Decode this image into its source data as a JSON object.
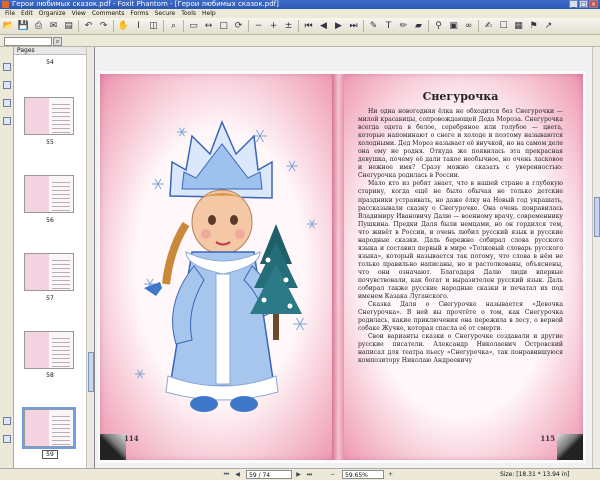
{
  "window": {
    "title": "Герои любимых сказок.pdf - Foxit Phantom - [Герои любимых сказок.pdf]"
  },
  "menu": [
    "File",
    "Edit",
    "Organize",
    "View",
    "Comments",
    "Forms",
    "Secure",
    "Tools",
    "Help"
  ],
  "toolbar": {
    "icons": [
      "open-icon",
      "save-icon",
      "print-icon",
      "email-icon",
      "scan-icon",
      "sep",
      "undo-icon",
      "redo-icon",
      "sep",
      "hand-icon",
      "select-text-icon",
      "snapshot-icon",
      "sep",
      "zoom-icon",
      "sep",
      "fit-page-icon",
      "fit-width-icon",
      "actual-size-icon",
      "rotate-icon",
      "sep",
      "zoom-out-icon",
      "zoom-in-icon",
      "zoom-in-out-icon",
      "sep",
      "first-page-icon",
      "prev-page-icon",
      "next-page-icon",
      "last-page-icon",
      "sep",
      "comment-icon",
      "typewriter-icon",
      "pencil-icon",
      "highlight-icon",
      "sep",
      "attach-icon",
      "stamp-icon",
      "link-icon",
      "sep",
      "sign-icon",
      "form-icon",
      "grid-icon",
      "bookmark-icon",
      "extract-icon"
    ]
  },
  "pages_panel": {
    "title": "Pages",
    "thumbnails": [
      {
        "label": "54",
        "selected": false
      },
      {
        "label": "55",
        "selected": false
      },
      {
        "label": "56",
        "selected": false
      },
      {
        "label": "57",
        "selected": false
      },
      {
        "label": "58",
        "selected": false
      },
      {
        "label": "59",
        "selected": true
      }
    ]
  },
  "book": {
    "left_page_number": "114",
    "right_page_number": "115",
    "title": "Снегурочка",
    "paragraphs": [
      "Ни одна новогодняя ёлка не обходится без Снегурочки — милой красавицы, сопровождающей Деда Мороза. Снегурочка всегда одета в белое, серебряное или голубое — цвета, которые напоминают о снеге и холоде и поэтому называются холодными. Дед Мороз называет её внучкой, но на самом деле она ему не родня. Откуда же появилась эта прекрасная девушка, почему её дали такое необычное, но очень ласковое и нежное имя? Сразу можно сказать с уверенностью: Снегурочка родилась в России.",
      "Мало кто из ребят знает, что в нашей стране в глубокую старину, когда ещё не было обычая не только детские праздники устраивать, но даже ёлку на Новый год украшать, рассказывали сказку о Снегурочке. Она очень понравилась Владимиру Ивановичу Далю — военному врачу, современнику Пушкина. Предки Даля были немцами, но он гордился тем, что живёт в России, и очень любил русский язык и русские народные сказки. Даль бережно собирал слова русского языка и составил первый в мире «Толковый словарь русского языка», который называется так потому, что слова в нём не только правильно написаны, но и растолкованы, объяснены, что они означают. Благодаря Далю люди впервые почувствовали, как богат и выразителен русский язык. Даль собирал также русские народные сказки и печатал их под именем Казака Луганского.",
      "Сказка Даля о Снегурочке называется «Девочка Снегурочка». В ней вы прочтёте о том, как Снегурочка родилась, какие приключения она пережила в лесу, о верной собаке Жучке, которая спасла её от смерти.",
      "Свои варианты сказки о Снегурочке создавали и другие русские писатели. Александр Николаевич Островский написал для театра пьесу «Снегурочка», так понравившуюся композитору Николаю Андреевичу"
    ]
  },
  "statusbar": {
    "page_field": "59 / 74",
    "zoom_field": "59.65%",
    "size_text": "Size: [18.31 * 13.94 in]"
  },
  "colors": {
    "title_bar": "#2a57b3",
    "page_pink": "#efa1b8",
    "selection": "#6f9ee6"
  }
}
